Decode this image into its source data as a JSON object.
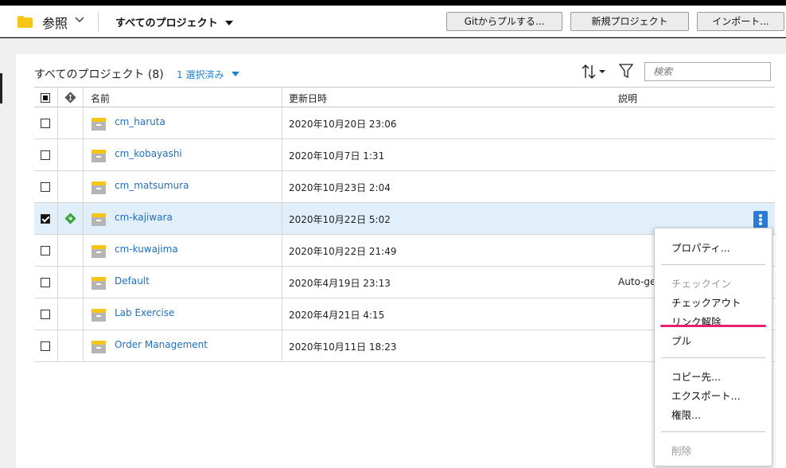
{
  "header": {
    "browse_label": "参照",
    "projects_dropdown": "すべてのプロジェクト",
    "buttons": {
      "git_pull": "Gitからプルする...",
      "new_project": "新規プロジェクト",
      "import": "インポート..."
    }
  },
  "list": {
    "title": "すべてのプロジェクト (8)",
    "selected_count": "1 選択済み",
    "search_placeholder": "検索"
  },
  "table": {
    "columns": {
      "name": "名前",
      "updated": "更新日時",
      "description": "説明"
    },
    "rows": [
      {
        "name": "cm_haruta",
        "updated": "2020年10月20日 23:06",
        "description": "",
        "checked": false,
        "git_linked": false
      },
      {
        "name": "cm_kobayashi",
        "updated": "2020年10月7日 1:31",
        "description": "",
        "checked": false,
        "git_linked": false
      },
      {
        "name": "cm_matsumura",
        "updated": "2020年10月23日 2:04",
        "description": "",
        "checked": false,
        "git_linked": false
      },
      {
        "name": "cm-kajiwara",
        "updated": "2020年10月22日 5:02",
        "description": "",
        "checked": true,
        "git_linked": true
      },
      {
        "name": "cm-kuwajima",
        "updated": "2020年10月22日 21:49",
        "description": "",
        "checked": false,
        "git_linked": false
      },
      {
        "name": "Default",
        "updated": "2020年4月19日 23:13",
        "description": "Auto-generated",
        "checked": false,
        "git_linked": false
      },
      {
        "name": "Lab Exercise",
        "updated": "2020年4月21日 4:15",
        "description": "",
        "checked": false,
        "git_linked": false
      },
      {
        "name": "Order Management",
        "updated": "2020年10月11日 18:23",
        "description": "",
        "checked": false,
        "git_linked": false
      }
    ]
  },
  "context_menu": {
    "properties": "プロパティ...",
    "checkin": "チェックイン",
    "checkout": "チェックアウト",
    "unlink": "リンク解除",
    "pull": "プル",
    "copy_to": "コピー先...",
    "export": "エクスポート...",
    "permissions": "権限...",
    "delete": "削除"
  },
  "colors": {
    "link_blue": "#1e7fd0",
    "selected_row": "#e1effa",
    "kebab_blue": "#2a7bd6",
    "highlight": "#e8206e",
    "folder_yellow": "#f5c518",
    "git_green": "#3aa63a"
  }
}
